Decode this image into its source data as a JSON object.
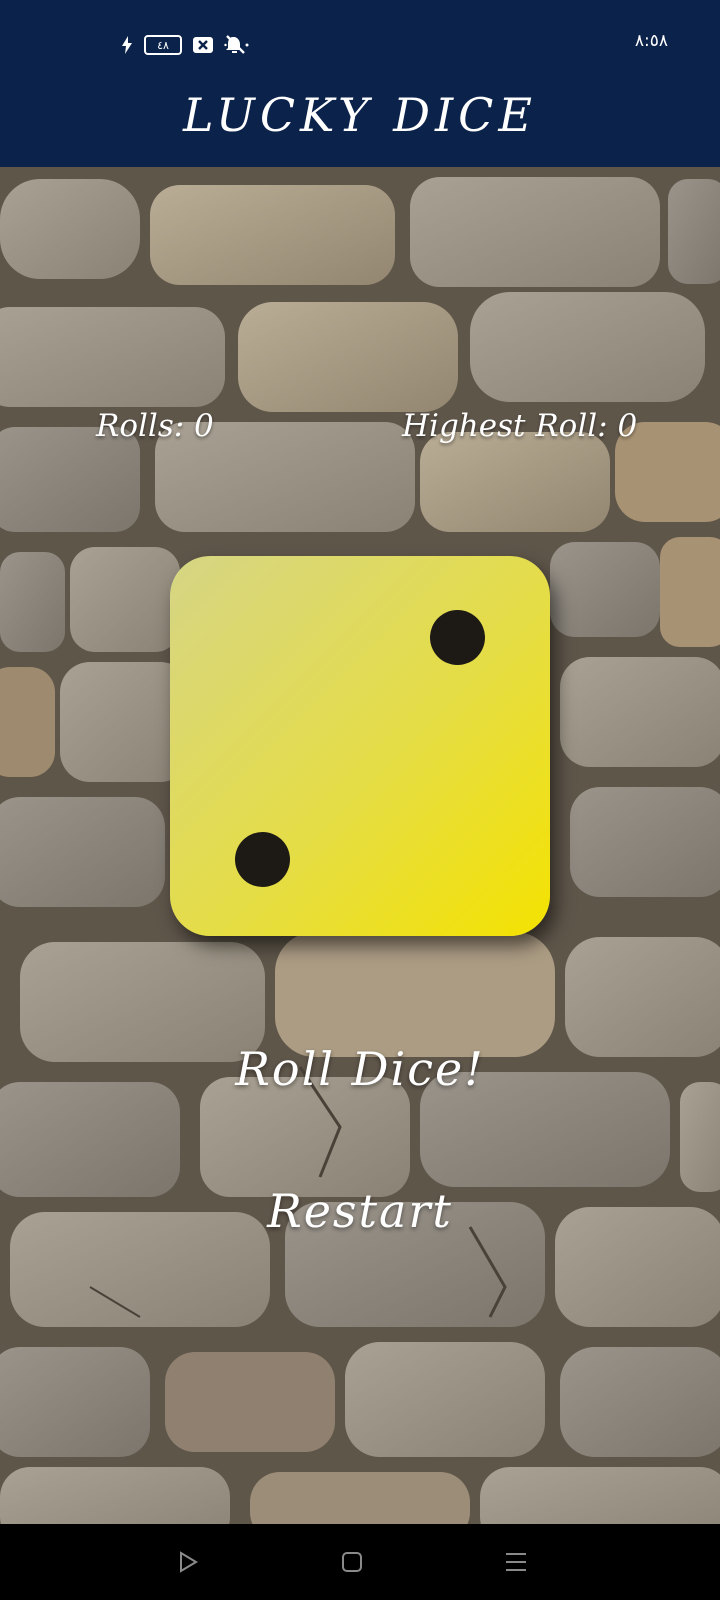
{
  "status_bar": {
    "time": "٨:٥٨",
    "battery": "٤٨",
    "icons": [
      "charging-icon",
      "battery-icon",
      "close-box-icon",
      "mute-icon"
    ]
  },
  "header": {
    "title": "LUCKY DICE"
  },
  "stats": {
    "rolls": "Rolls: 0",
    "highest": "Highest Roll: 0"
  },
  "dice": {
    "value": 2,
    "colors": {
      "face_start": "#d6d585",
      "face_end": "#f4e200",
      "pip": "#1d1a16"
    }
  },
  "actions": {
    "roll": "Roll Dice!",
    "restart": "Restart"
  },
  "navbar": {
    "icons": [
      "back-triangle-icon",
      "home-square-icon",
      "menu-lines-icon"
    ]
  },
  "colors": {
    "header_bg": "#0b224b",
    "navbar_bg": "#000000",
    "text": "#ffffff"
  }
}
